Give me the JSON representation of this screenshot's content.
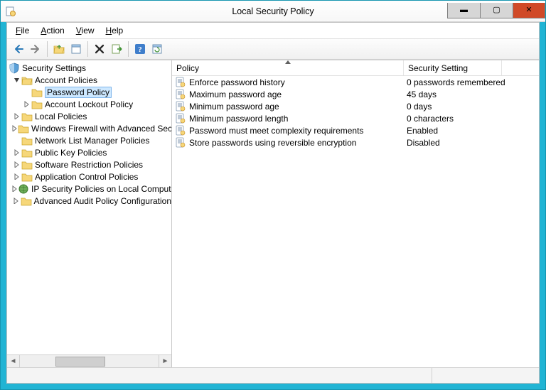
{
  "window": {
    "title": "Local Security Policy"
  },
  "menus": {
    "file": "File",
    "action": "Action",
    "view": "View",
    "help": "Help"
  },
  "tree": {
    "root": "Security Settings",
    "account_policies": "Account Policies",
    "password_policy": "Password Policy",
    "account_lockout_policy": "Account Lockout Policy",
    "local_policies": "Local Policies",
    "windows_firewall": "Windows Firewall with Advanced Security",
    "network_list": "Network List Manager Policies",
    "public_key": "Public Key Policies",
    "software_restriction": "Software Restriction Policies",
    "app_control": "Application Control Policies",
    "ip_security": "IP Security Policies on Local Computer",
    "adv_audit": "Advanced Audit Policy Configuration"
  },
  "columns": {
    "policy": "Policy",
    "setting": "Security Setting"
  },
  "policies": [
    {
      "name": "Enforce password history",
      "value": "0 passwords remembered"
    },
    {
      "name": "Maximum password age",
      "value": "45 days"
    },
    {
      "name": "Minimum password age",
      "value": "0 days"
    },
    {
      "name": "Minimum password length",
      "value": "0 characters"
    },
    {
      "name": "Password must meet complexity requirements",
      "value": "Enabled"
    },
    {
      "name": "Store passwords using reversible encryption",
      "value": "Disabled"
    }
  ]
}
